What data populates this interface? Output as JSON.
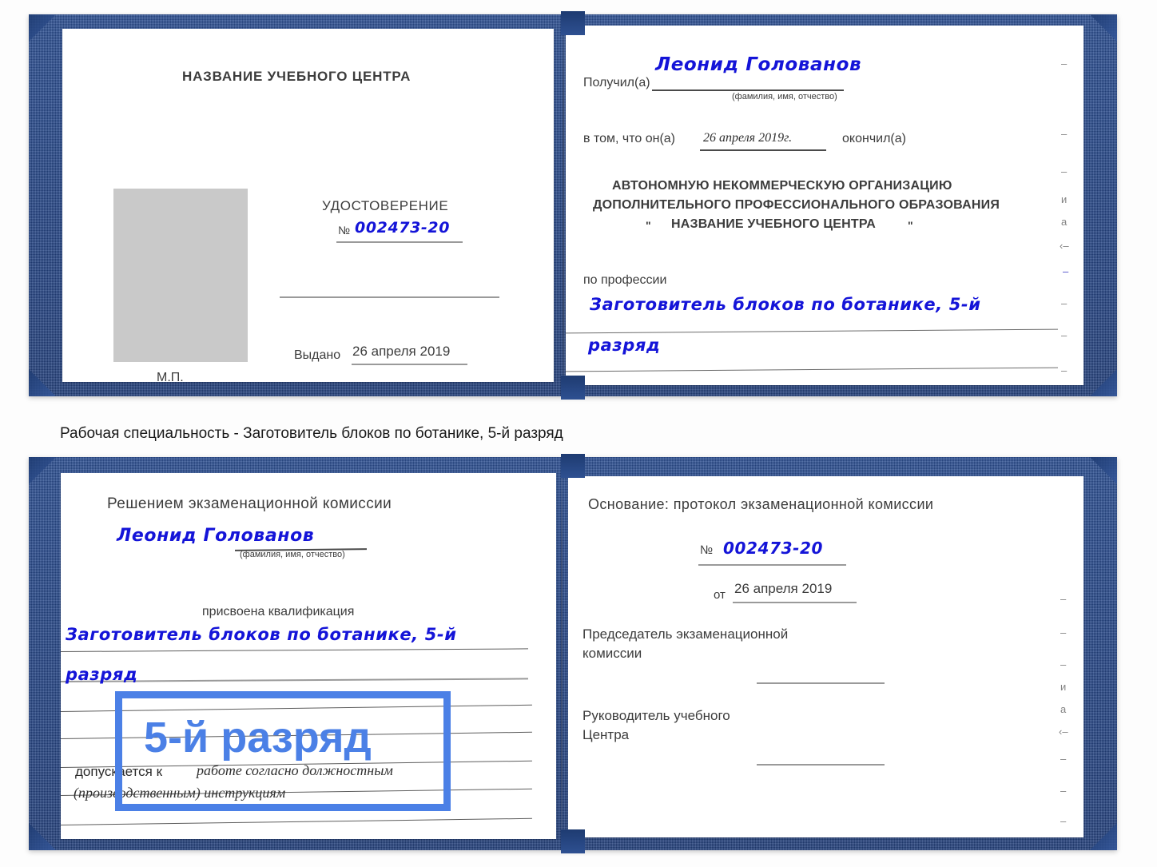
{
  "document": {
    "kind": "certificate-scan",
    "caption": "Рабочая специальность - Заготовитель блоков по ботанике, 5-й разряд"
  },
  "colors": {
    "cover_blue": "#27488a",
    "ink_blue": "#1414d8",
    "annotation_blue": "#4b80e6",
    "paper_white": "#ffffff",
    "photo_gray": "#c9c9c9",
    "text_gray": "#3c3c3c"
  },
  "certificate_top": {
    "left_page": {
      "header": "НАЗВАНИЕ УЧЕБНОГО ЦЕНТРА",
      "photo_placeholder": "photo-placeholder",
      "title": "УДОСТОВЕРЕНИЕ",
      "number_label": "№",
      "number_value": "002473-20",
      "issued_label": "Выдано",
      "issued_value": "26 апреля 2019",
      "stamp_label": "М.П."
    },
    "right_page": {
      "received_label": "Получил(а)",
      "received_value": "Леонид Голованов",
      "fio_hint": "(фамилия, имя, отчество)",
      "that_he_label": "в том, что он(а)",
      "that_he_value": "26 апреля 2019г.",
      "finished_label": "окончил(а)",
      "org_line1": "АВТОНОМНУЮ НЕКОММЕРЧЕСКУЮ ОРГАНИЗАЦИЮ",
      "org_line2": "ДОПОЛНИТЕЛЬНОГО ПРОФЕССИОНАЛЬНОГО ОБРАЗОВАНИЯ",
      "org_quote_open": "\"",
      "org_name": "НАЗВАНИЕ УЧЕБНОГО ЦЕНТРА",
      "org_quote_close": "\"",
      "profession_label": "по профессии",
      "profession_value_line1": "Заготовитель блоков по ботанике, 5-й",
      "profession_value_line2": "разряд"
    }
  },
  "certificate_bottom": {
    "left_page": {
      "decision_header": "Решением экзаменационной комиссии",
      "name_value": "Леонид Голованов",
      "fio_hint": "(фамилия, имя, отчество)",
      "qualification_label": "присвоена квалификация",
      "qualification_line1": "Заготовитель блоков по ботанике, 5-й",
      "qualification_line2": "разряд",
      "allowed_label": "допускается к",
      "allowed_value_line1": "работе согласно должностным",
      "allowed_value_line2": "(производственным) инструкциям"
    },
    "right_page": {
      "basis_label": "Основание: протокол экзаменационной комиссии",
      "number_label": "№",
      "number_value": "002473-20",
      "from_label": "от",
      "from_value": "26 апреля 2019",
      "chairman_line1": "Председатель экзаменационной",
      "chairman_line2": "комиссии",
      "head_line1": "Руководитель учебного",
      "head_line2": "Центра"
    }
  },
  "annotation": {
    "highlight_text": "5-й разряд",
    "highlight_color": "#4b80e6"
  },
  "edge_fragments": {
    "top": [
      "–",
      "–",
      "–",
      "и",
      "а",
      "‹–",
      "–",
      "–",
      "–",
      "–"
    ],
    "bottom": [
      "–",
      "–",
      "–",
      "и",
      "а",
      "‹–",
      "–",
      "–",
      "–"
    ]
  }
}
